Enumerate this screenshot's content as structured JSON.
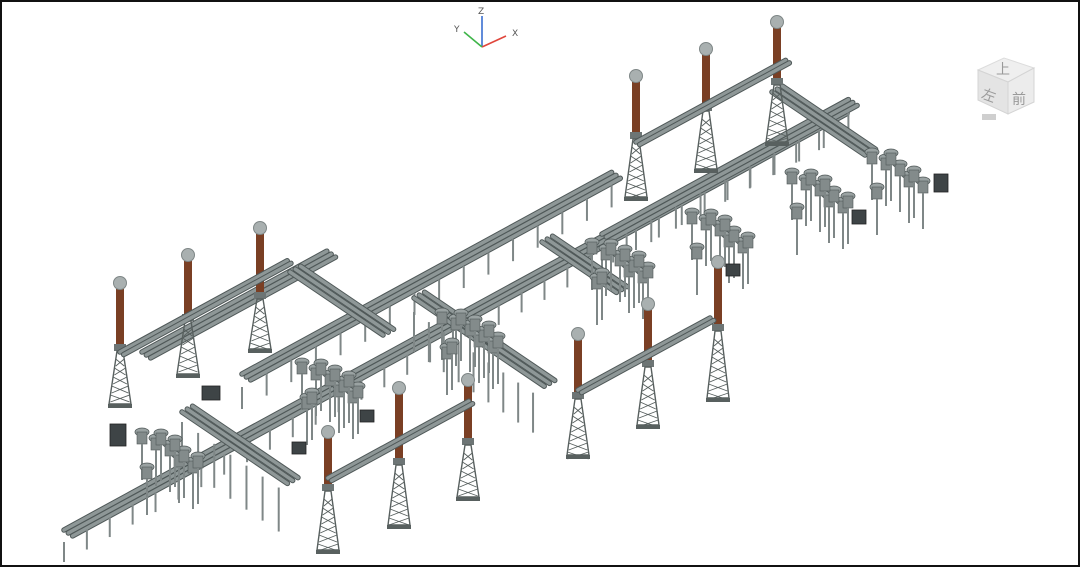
{
  "axis_triad": {
    "z_label": "Z",
    "y_label": "Y",
    "x_label": "X",
    "x_color": "#e0463c",
    "y_color": "#3fb54a",
    "z_color": "#3a6fd0"
  },
  "view_cube": {
    "top_label": "上",
    "front_label": "前",
    "left_label": "左"
  },
  "model": {
    "pipe_color": "#8e9797",
    "pipe_edge_color": "#4f5858",
    "insulator_color": "#7a3f24",
    "cap_color": "#a9b0b0",
    "tower_color": "#58605f",
    "equipment_color": "#3e4446",
    "background_color": "#ffffff"
  }
}
